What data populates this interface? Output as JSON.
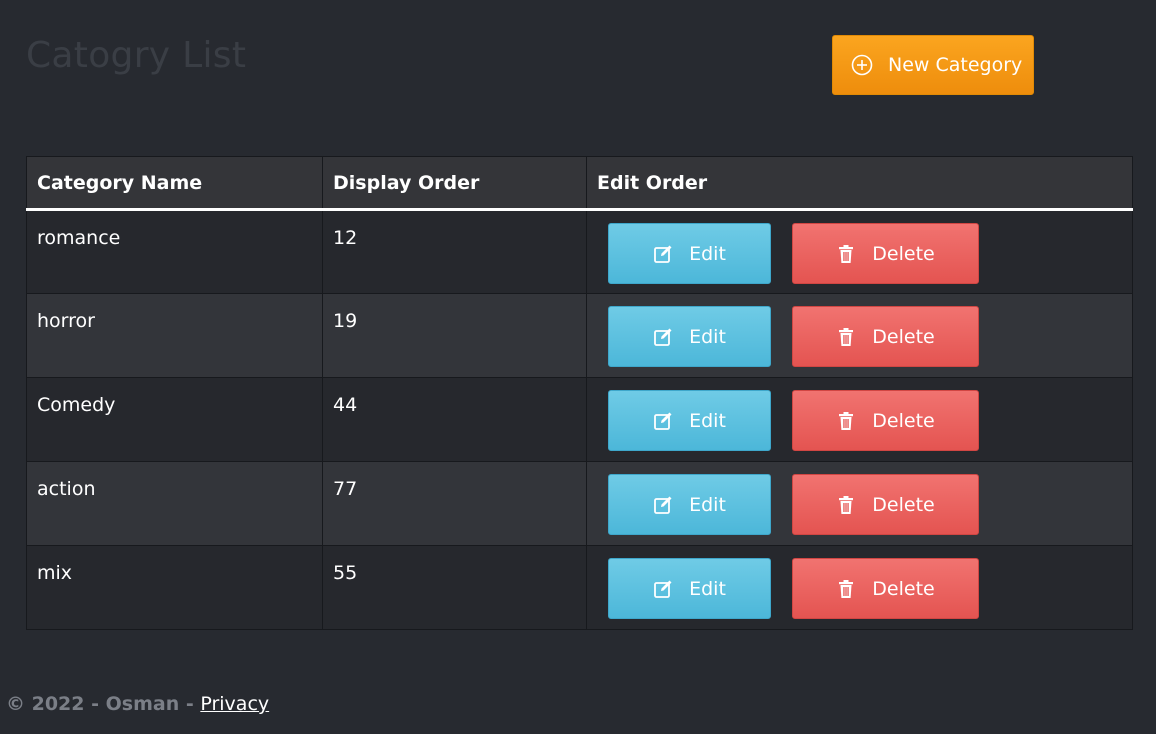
{
  "header": {
    "title": "Catogry List",
    "new_button_label": "New Category",
    "new_button_icon": "plus-circle-icon"
  },
  "table": {
    "columns": [
      "Category Name",
      "Display Order",
      "Edit Order"
    ],
    "rows": [
      {
        "name": "romance",
        "order": "12"
      },
      {
        "name": "horror",
        "order": "19"
      },
      {
        "name": "Comedy",
        "order": "44"
      },
      {
        "name": "action",
        "order": "77"
      },
      {
        "name": "mix",
        "order": "55"
      }
    ],
    "edit_label": "Edit",
    "delete_label": "Delete",
    "edit_icon": "pencil-square-icon",
    "delete_icon": "trash-icon"
  },
  "footer": {
    "copyright": "© 2022 - Osman - ",
    "privacy_link": "Privacy"
  },
  "colors": {
    "background": "#272a30",
    "primary_warning": "#f7981a",
    "info": "#5bc0de",
    "danger": "#e9615e"
  }
}
